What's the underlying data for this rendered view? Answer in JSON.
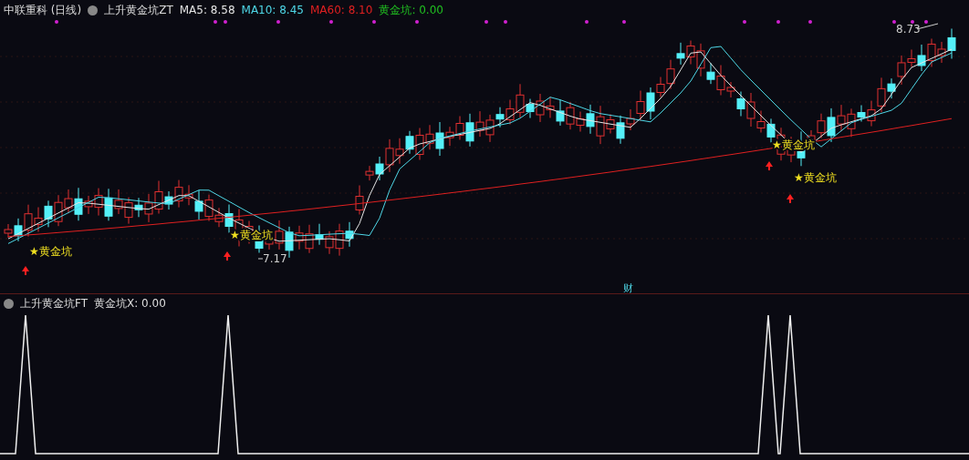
{
  "main_panel": {
    "stock": "中联重科 (日线)",
    "indicator": "上升黄金坑ZT",
    "legend": [
      {
        "label": "MA5: 8.58",
        "color": "#e6e6e6"
      },
      {
        "label": "MA10: 8.45",
        "color": "#4fd8e8"
      },
      {
        "label": "MA60: 8.10",
        "color": "#e02020"
      },
      {
        "label": "黄金坑: 0.00",
        "color": "#20c020"
      }
    ],
    "signals": [
      "★黄金坑",
      "★黄金坑",
      "★黄金坑",
      "★黄金坑"
    ],
    "low_label": "7.17",
    "high_label": "8.73",
    "event_marker": "财"
  },
  "sub_panel": {
    "indicator": "上升黄金坑FT",
    "value": "黄金坑X: 0.00"
  }
}
